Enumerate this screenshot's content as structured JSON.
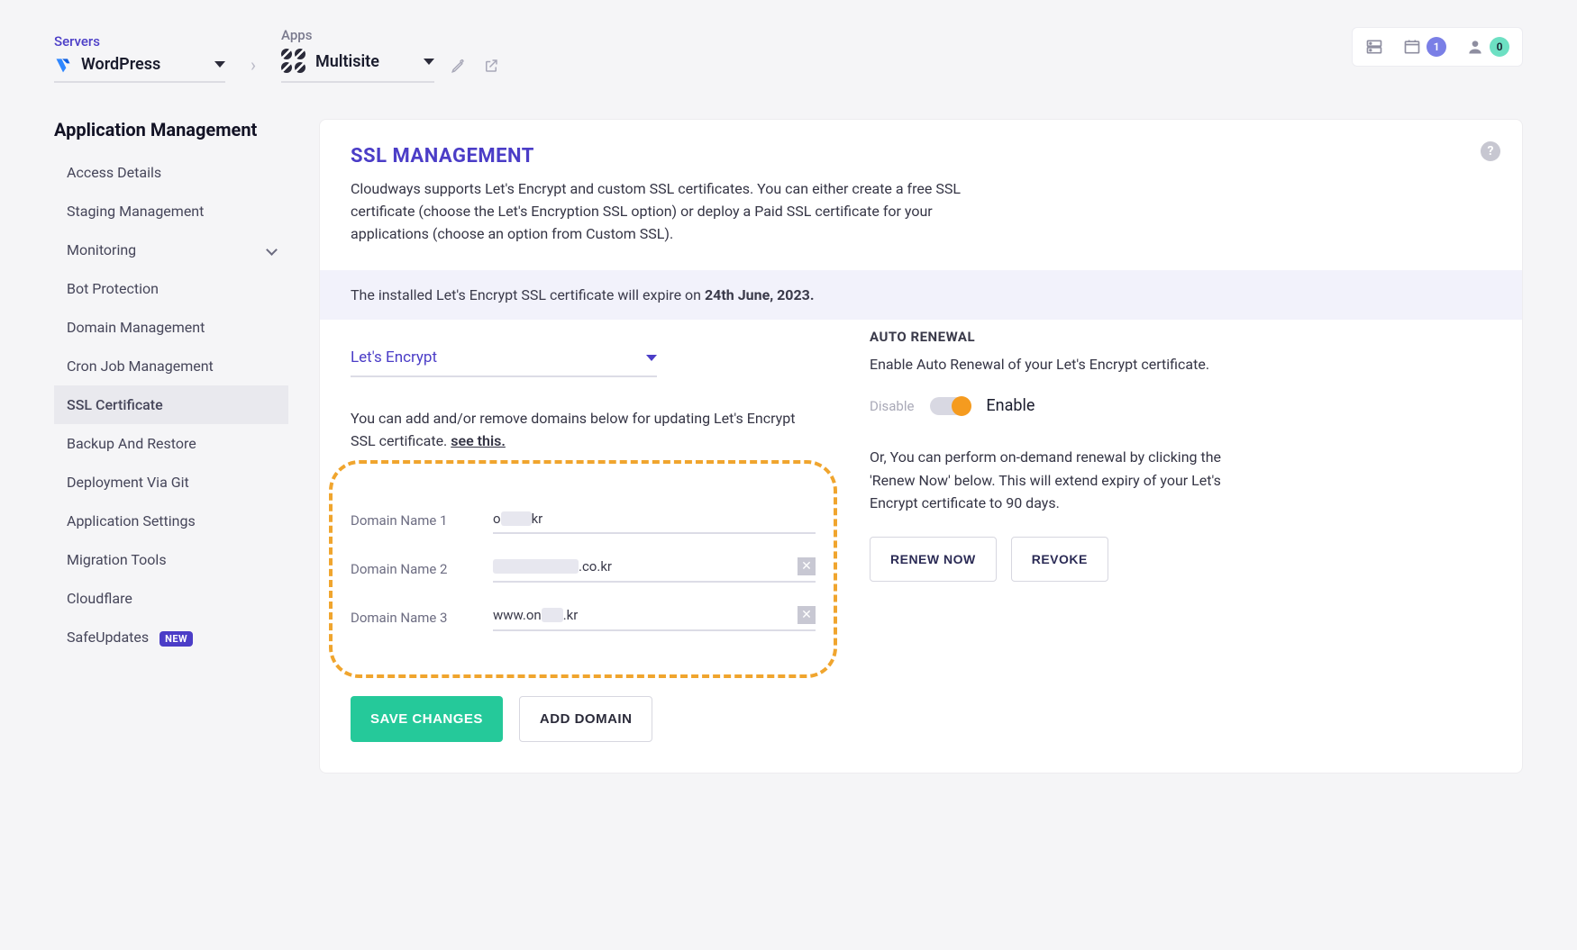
{
  "breadcrumb": {
    "servers_label": "Servers",
    "server_name": "WordPress",
    "apps_label": "Apps",
    "app_name": "Multisite"
  },
  "top_right": {
    "servers_count": "",
    "apps_badge": "1",
    "user_badge": "0"
  },
  "sidebar": {
    "title": "Application Management",
    "items": [
      {
        "label": "Access Details"
      },
      {
        "label": "Staging Management"
      },
      {
        "label": "Monitoring",
        "expandable": true
      },
      {
        "label": "Bot Protection"
      },
      {
        "label": "Domain Management"
      },
      {
        "label": "Cron Job Management"
      },
      {
        "label": "SSL Certificate",
        "active": true
      },
      {
        "label": "Backup And Restore"
      },
      {
        "label": "Deployment Via Git"
      },
      {
        "label": "Application Settings"
      },
      {
        "label": "Migration Tools"
      },
      {
        "label": "Cloudflare"
      },
      {
        "label": "SafeUpdates",
        "badge": "NEW"
      }
    ]
  },
  "panel": {
    "title": "SSL MANAGEMENT",
    "desc": "Cloudways supports Let's Encrypt and custom SSL certificates. You can either create a free SSL certificate (choose the Let's Encryption SSL option) or deploy a Paid SSL certificate for your applications (choose an option from Custom SSL).",
    "expiry_prefix": "The installed Let's Encrypt SSL certificate will expire on ",
    "expiry_date": "24th June, 2023.",
    "ssl_type": "Let's Encrypt",
    "domain_help": "You can add and/or remove domains below for updating Let's Encrypt SSL certificate.  ",
    "see_this": "see this.",
    "domains": [
      {
        "label": "Domain Name 1",
        "prefix": "o",
        "redacted_w": 34,
        "suffix": "kr",
        "removable": false
      },
      {
        "label": "Domain Name 2",
        "prefix": "",
        "redacted_w": 95,
        "suffix": ".co.kr",
        "removable": true
      },
      {
        "label": "Domain Name 3",
        "prefix": "www.on",
        "redacted_w": 24,
        "suffix": ".kr",
        "removable": true
      }
    ],
    "btn_save": "SAVE CHANGES",
    "btn_add": "ADD DOMAIN"
  },
  "right": {
    "title": "AUTO RENEWAL",
    "desc": "Enable Auto Renewal of your Let's Encrypt certificate.",
    "toggle_off": "Disable",
    "toggle_on": "Enable",
    "renew_desc": "Or, You can perform on-demand renewal by clicking the 'Renew Now' below. This will extend expiry of your Let's Encrypt certificate to 90 days.",
    "btn_renew": "RENEW NOW",
    "btn_revoke": "REVOKE"
  }
}
